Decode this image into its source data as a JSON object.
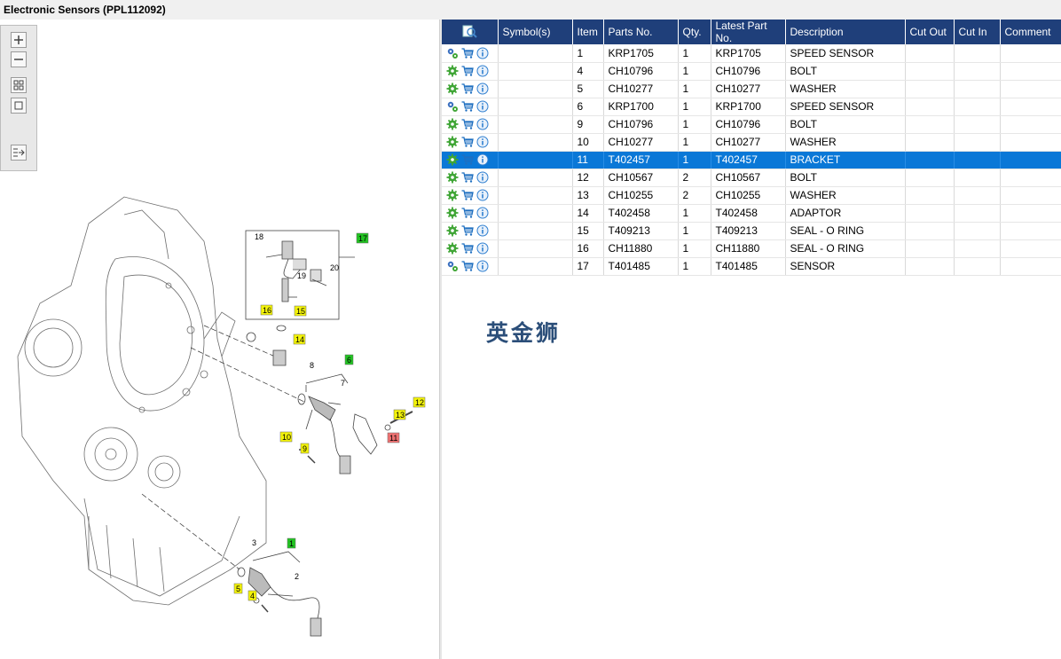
{
  "window": {
    "title": "Electronic Sensors (PPL112092)"
  },
  "toolbar": {
    "buttons": [
      {
        "name": "zoom-in-button",
        "icon": "plus-icon"
      },
      {
        "name": "zoom-out-button",
        "icon": "minus-icon"
      },
      {
        "name": "fit-all-button",
        "icon": "grid-icon"
      },
      {
        "name": "actual-size-button",
        "icon": "square-icon"
      },
      {
        "name": "export-button",
        "icon": "list-arrow-icon"
      }
    ]
  },
  "diagram": {
    "callouts": [
      {
        "label": "17",
        "color": "#22c422"
      },
      {
        "label": "18",
        "color": ""
      },
      {
        "label": "19",
        "color": ""
      },
      {
        "label": "20",
        "color": ""
      },
      {
        "label": "16",
        "color": "#f4f40a"
      },
      {
        "label": "15",
        "color": "#f4f40a"
      },
      {
        "label": "14",
        "color": "#f4f40a"
      },
      {
        "label": "6",
        "color": "#22c422"
      },
      {
        "label": "8",
        "color": ""
      },
      {
        "label": "7",
        "color": ""
      },
      {
        "label": "12",
        "color": "#f4f40a"
      },
      {
        "label": "13",
        "color": "#f4f40a"
      },
      {
        "label": "11",
        "color": "#f07272"
      },
      {
        "label": "10",
        "color": "#f4f40a"
      },
      {
        "label": "9",
        "color": "#f4f40a"
      },
      {
        "label": "1",
        "color": "#22c422"
      },
      {
        "label": "3",
        "color": ""
      },
      {
        "label": "2",
        "color": ""
      },
      {
        "label": "5",
        "color": "#f4f40a"
      },
      {
        "label": "4",
        "color": "#f4f40a"
      }
    ]
  },
  "table": {
    "headers": [
      "",
      "Symbol(s)",
      "Item",
      "Parts No.",
      "Qty.",
      "Latest Part No.",
      "Description",
      "Cut Out",
      "Cut In",
      "Comment"
    ],
    "rows": [
      {
        "icon": "gears-icon",
        "symbols": "",
        "item": "1",
        "part_no": "KRP1705",
        "qty": "1",
        "latest": "KRP1705",
        "description": "SPEED SENSOR",
        "cut_out": "",
        "cut_in": "",
        "comment": ""
      },
      {
        "icon": "gear-icon",
        "symbols": "",
        "item": "4",
        "part_no": "CH10796",
        "qty": "1",
        "latest": "CH10796",
        "description": "BOLT",
        "cut_out": "",
        "cut_in": "",
        "comment": ""
      },
      {
        "icon": "gear-icon",
        "symbols": "",
        "item": "5",
        "part_no": "CH10277",
        "qty": "1",
        "latest": "CH10277",
        "description": "WASHER",
        "cut_out": "",
        "cut_in": "",
        "comment": ""
      },
      {
        "icon": "gears-icon",
        "symbols": "",
        "item": "6",
        "part_no": "KRP1700",
        "qty": "1",
        "latest": "KRP1700",
        "description": "SPEED SENSOR",
        "cut_out": "",
        "cut_in": "",
        "comment": ""
      },
      {
        "icon": "gear-icon",
        "symbols": "",
        "item": "9",
        "part_no": "CH10796",
        "qty": "1",
        "latest": "CH10796",
        "description": "BOLT",
        "cut_out": "",
        "cut_in": "",
        "comment": ""
      },
      {
        "icon": "gear-icon",
        "symbols": "",
        "item": "10",
        "part_no": "CH10277",
        "qty": "1",
        "latest": "CH10277",
        "description": "WASHER",
        "cut_out": "",
        "cut_in": "",
        "comment": ""
      },
      {
        "icon": "gear-icon",
        "symbols": "",
        "item": "11",
        "part_no": "T402457",
        "qty": "1",
        "latest": "T402457",
        "description": "BRACKET",
        "cut_out": "",
        "cut_in": "",
        "comment": "",
        "selected": true
      },
      {
        "icon": "gear-icon",
        "symbols": "",
        "item": "12",
        "part_no": "CH10567",
        "qty": "2",
        "latest": "CH10567",
        "description": "BOLT",
        "cut_out": "",
        "cut_in": "",
        "comment": ""
      },
      {
        "icon": "gear-icon",
        "symbols": "",
        "item": "13",
        "part_no": "CH10255",
        "qty": "2",
        "latest": "CH10255",
        "description": "WASHER",
        "cut_out": "",
        "cut_in": "",
        "comment": ""
      },
      {
        "icon": "gear-icon",
        "symbols": "",
        "item": "14",
        "part_no": "T402458",
        "qty": "1",
        "latest": "T402458",
        "description": "ADAPTOR",
        "cut_out": "",
        "cut_in": "",
        "comment": ""
      },
      {
        "icon": "gear-icon",
        "symbols": "",
        "item": "15",
        "part_no": "T409213",
        "qty": "1",
        "latest": "T409213",
        "description": "SEAL - O RING",
        "cut_out": "",
        "cut_in": "",
        "comment": ""
      },
      {
        "icon": "gear-icon",
        "symbols": "",
        "item": "16",
        "part_no": "CH11880",
        "qty": "1",
        "latest": "CH11880",
        "description": "SEAL - O RING",
        "cut_out": "",
        "cut_in": "",
        "comment": ""
      },
      {
        "icon": "gears-icon",
        "symbols": "",
        "item": "17",
        "part_no": "T401485",
        "qty": "1",
        "latest": "T401485",
        "description": "SENSOR",
        "cut_out": "",
        "cut_in": "",
        "comment": ""
      }
    ]
  },
  "watermark": {
    "text": "英金狮"
  },
  "colors": {
    "header": "#1f3f7a",
    "selection": "#0a78d7",
    "gear": "#3fa535",
    "cart": "#1f6fc0",
    "info": "#2f7fd0"
  }
}
